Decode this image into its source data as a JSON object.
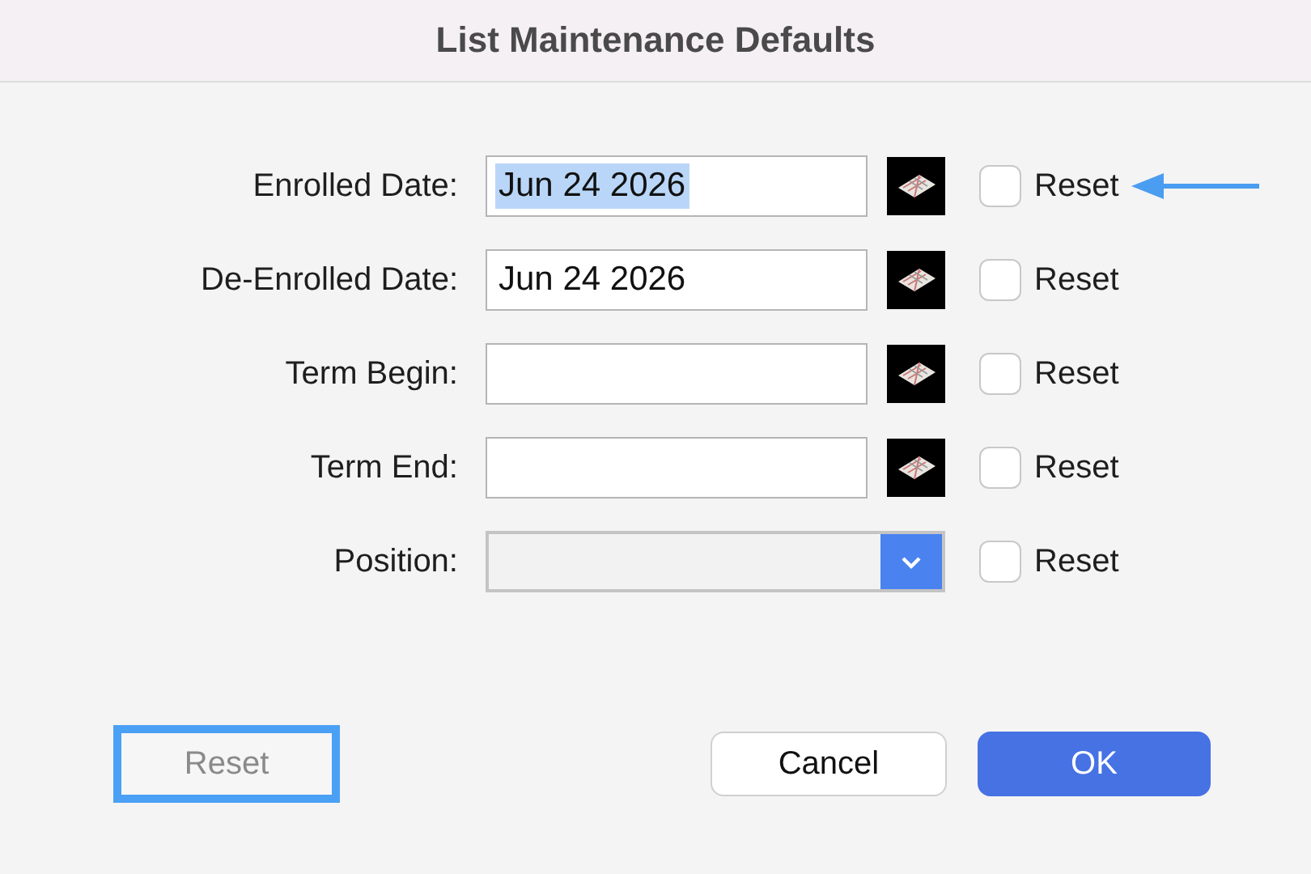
{
  "window": {
    "title": "List Maintenance Defaults"
  },
  "fields": [
    {
      "label": "Enrolled Date:",
      "kind": "date",
      "value": "Jun 24 2026",
      "text_selected": true,
      "reset": {
        "label": "Reset",
        "checked": false
      },
      "pointer": true
    },
    {
      "label": "De-Enrolled Date:",
      "kind": "date",
      "value": "Jun 24 2026",
      "text_selected": false,
      "reset": {
        "label": "Reset",
        "checked": false
      },
      "pointer": false
    },
    {
      "label": "Term Begin:",
      "kind": "date",
      "reset": {
        "label": "Reset",
        "checked": false
      },
      "pointer": false
    },
    {
      "label": "Term End:",
      "kind": "date",
      "reset": {
        "label": "Reset",
        "checked": false
      },
      "pointer": false
    },
    {
      "label": "Position:",
      "kind": "select",
      "reset": {
        "label": "Reset",
        "checked": false
      },
      "pointer": false
    }
  ],
  "buttons": [
    {
      "label": "Reset",
      "kind": "plain",
      "disabled": true,
      "focused": true
    },
    {
      "label": "Cancel",
      "kind": "plain",
      "disabled": false,
      "focused": false
    },
    {
      "label": "OK",
      "kind": "default",
      "disabled": false,
      "focused": false
    }
  ]
}
